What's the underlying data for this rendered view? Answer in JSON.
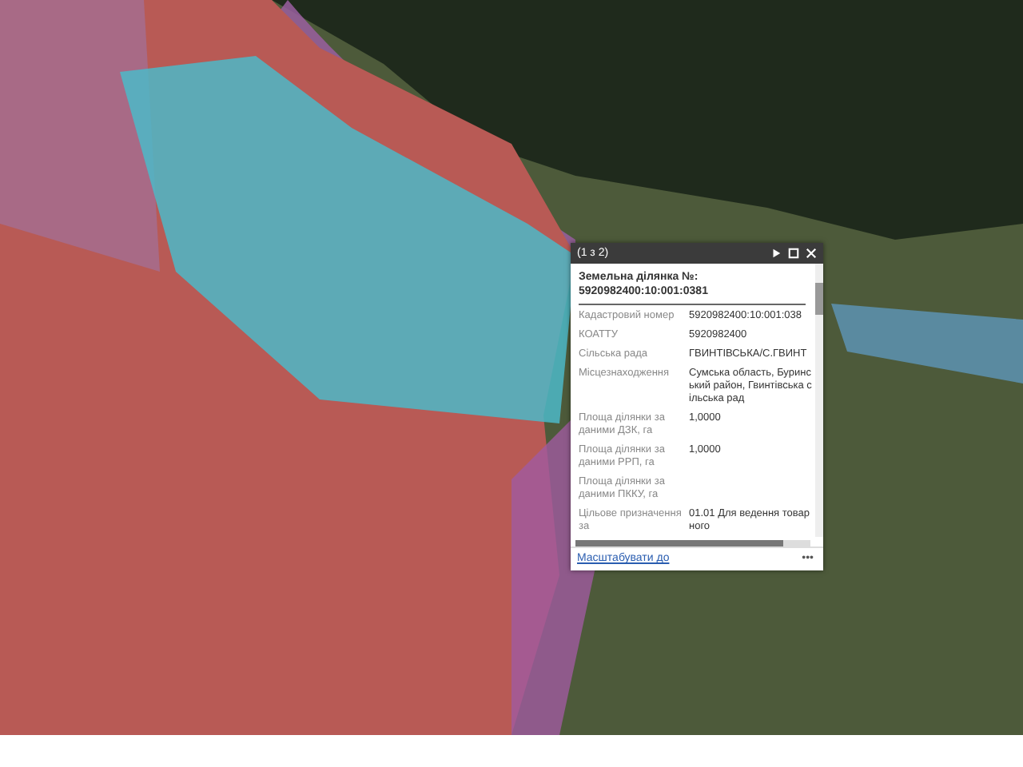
{
  "popup": {
    "counter": "(1 з 2)",
    "title": "Земельна ділянка №: 5920982400:10:001:0381",
    "fields": [
      {
        "label": "Кадастровий номер",
        "value": "5920982400:10:001:038"
      },
      {
        "label": "КОАТТУ",
        "value": "5920982400"
      },
      {
        "label": "Сільська рада",
        "value": "ГВИНТІВСЬКА/С.ГВИНТ"
      },
      {
        "label": "Місцезнаходження",
        "value": "Сумська область, Буринський район, Гвинтівська сільська рад"
      },
      {
        "label": "Площа ділянки за даними ДЗК, га",
        "value": "1,0000"
      },
      {
        "label": "Площа ділянки за даними РРП, га",
        "value": "1,0000"
      },
      {
        "label": "Площа ділянки за даними ПККУ, га"
      },
      {
        "label": "Цільове призначення за",
        "value": "01.01 Для ведення товарного"
      }
    ],
    "zoom_link": "Масштабувати до",
    "more": "•••"
  }
}
